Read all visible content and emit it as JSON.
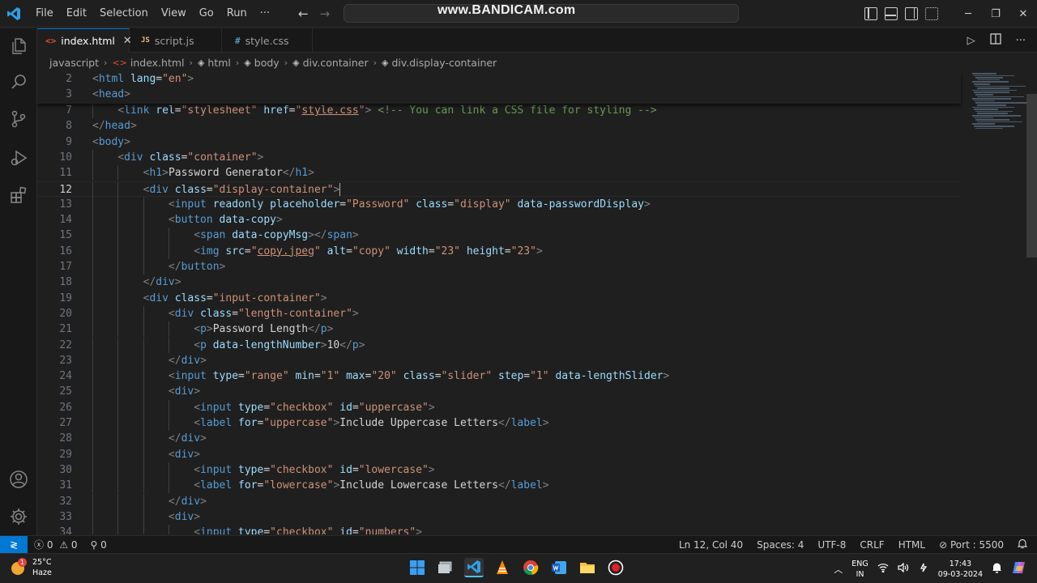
{
  "menu": {
    "items": [
      "File",
      "Edit",
      "Selection",
      "View",
      "Go",
      "Run",
      "···"
    ]
  },
  "titlebar": {
    "watermark": "www.BANDICAM.com",
    "window_controls": [
      "─",
      "❐",
      "✕"
    ]
  },
  "tabs": [
    {
      "label": "index.html",
      "icon": "<>",
      "icon_color": "#e44d26",
      "active": true,
      "close": "✕"
    },
    {
      "label": "script.js",
      "icon": "JS",
      "icon_color": "#e5c07b",
      "active": false
    },
    {
      "label": "style.css",
      "icon": "#",
      "icon_color": "#519aba",
      "active": false
    }
  ],
  "breadcrumb": [
    "javascript",
    "index.html",
    "html",
    "body",
    "div.container",
    "div.display-container"
  ],
  "editor": {
    "current_line": 12,
    "lines": [
      {
        "n": "2",
        "html": "<span class=\"p\">&lt;</span><span class=\"t\">html</span> <span class=\"a\">lang</span><span class=\"x\">=</span><span class=\"s\">\"en\"</span><span class=\"p\">&gt;</span>"
      },
      {
        "n": "3",
        "html": "<span class=\"p\">&lt;</span><span class=\"t\">head</span><span class=\"p\">&gt;</span>"
      },
      {
        "n": "7",
        "html": "    <span class=\"p\">&lt;</span><span class=\"t\">link</span> <span class=\"a\">rel</span><span class=\"x\">=</span><span class=\"s\">\"stylesheet\"</span> <span class=\"a\">href</span><span class=\"x\">=</span><span class=\"s\">\"</span><span class=\"u\">style.css</span><span class=\"s\">\"</span><span class=\"p\">&gt;</span> <span class=\"c\">&lt;!-- You can link a CSS file for styling --&gt;</span>"
      },
      {
        "n": "8",
        "html": "<span class=\"p\">&lt;/</span><span class=\"t\">head</span><span class=\"p\">&gt;</span>"
      },
      {
        "n": "9",
        "html": "<span class=\"p\">&lt;</span><span class=\"t\">body</span><span class=\"p\">&gt;</span>"
      },
      {
        "n": "10",
        "html": "    <span class=\"p\">&lt;</span><span class=\"t\">div</span> <span class=\"a\">class</span><span class=\"x\">=</span><span class=\"s\">\"container\"</span><span class=\"p\">&gt;</span>"
      },
      {
        "n": "11",
        "html": "        <span class=\"p\">&lt;</span><span class=\"t\">h1</span><span class=\"p\">&gt;</span><span class=\"x\">Password Generator</span><span class=\"p\">&lt;/</span><span class=\"t\">h1</span><span class=\"p\">&gt;</span>"
      },
      {
        "n": "12",
        "html": "        <span class=\"p\">&lt;</span><span class=\"t\">div</span> <span class=\"a\">class</span><span class=\"x\">=</span><span class=\"s\">\"display-container\"</span><span class=\"p\">&gt;</span><span class=\"caret\"></span>"
      },
      {
        "n": "13",
        "html": "            <span class=\"p\">&lt;</span><span class=\"t\">input</span> <span class=\"a\">readonly</span> <span class=\"a\">placeholder</span><span class=\"x\">=</span><span class=\"s\">\"Password\"</span> <span class=\"a\">class</span><span class=\"x\">=</span><span class=\"s\">\"display\"</span> <span class=\"a\">data-passwordDisplay</span><span class=\"p\">&gt;</span>"
      },
      {
        "n": "14",
        "html": "            <span class=\"p\">&lt;</span><span class=\"t\">button</span> <span class=\"a\">data-copy</span><span class=\"p\">&gt;</span>"
      },
      {
        "n": "15",
        "html": "                <span class=\"p\">&lt;</span><span class=\"t\">span</span> <span class=\"a\">data-copyMsg</span><span class=\"p\">&gt;&lt;/</span><span class=\"t\">span</span><span class=\"p\">&gt;</span>"
      },
      {
        "n": "16",
        "html": "                <span class=\"p\">&lt;</span><span class=\"t\">img</span> <span class=\"a\">src</span><span class=\"x\">=</span><span class=\"s\">\"</span><span class=\"u\">copy.jpeg</span><span class=\"s\">\"</span> <span class=\"a\">alt</span><span class=\"x\">=</span><span class=\"s\">\"copy\"</span> <span class=\"a\">width</span><span class=\"x\">=</span><span class=\"s\">\"23\"</span> <span class=\"a\">height</span><span class=\"x\">=</span><span class=\"s\">\"23\"</span><span class=\"p\">&gt;</span>"
      },
      {
        "n": "17",
        "html": "            <span class=\"p\">&lt;/</span><span class=\"t\">button</span><span class=\"p\">&gt;</span>"
      },
      {
        "n": "18",
        "html": "        <span class=\"p\">&lt;/</span><span class=\"t\">div</span><span class=\"p\">&gt;</span>"
      },
      {
        "n": "19",
        "html": "        <span class=\"p\">&lt;</span><span class=\"t\">div</span> <span class=\"a\">class</span><span class=\"x\">=</span><span class=\"s\">\"input-container\"</span><span class=\"p\">&gt;</span>"
      },
      {
        "n": "20",
        "html": "            <span class=\"p\">&lt;</span><span class=\"t\">div</span> <span class=\"a\">class</span><span class=\"x\">=</span><span class=\"s\">\"length-container\"</span><span class=\"p\">&gt;</span>"
      },
      {
        "n": "21",
        "html": "                <span class=\"p\">&lt;</span><span class=\"t\">p</span><span class=\"p\">&gt;</span><span class=\"x\">Password Length</span><span class=\"p\">&lt;/</span><span class=\"t\">p</span><span class=\"p\">&gt;</span>"
      },
      {
        "n": "22",
        "html": "                <span class=\"p\">&lt;</span><span class=\"t\">p</span> <span class=\"a\">data-lengthNumber</span><span class=\"p\">&gt;</span><span class=\"x\">10</span><span class=\"p\">&lt;/</span><span class=\"t\">p</span><span class=\"p\">&gt;</span>"
      },
      {
        "n": "23",
        "html": "            <span class=\"p\">&lt;/</span><span class=\"t\">div</span><span class=\"p\">&gt;</span>"
      },
      {
        "n": "24",
        "html": "            <span class=\"p\">&lt;</span><span class=\"t\">input</span> <span class=\"a\">type</span><span class=\"x\">=</span><span class=\"s\">\"range\"</span> <span class=\"a\">min</span><span class=\"x\">=</span><span class=\"s\">\"1\"</span> <span class=\"a\">max</span><span class=\"x\">=</span><span class=\"s\">\"20\"</span> <span class=\"a\">class</span><span class=\"x\">=</span><span class=\"s\">\"slider\"</span> <span class=\"a\">step</span><span class=\"x\">=</span><span class=\"s\">\"1\"</span> <span class=\"a\">data-lengthSlider</span><span class=\"p\">&gt;</span>"
      },
      {
        "n": "25",
        "html": "            <span class=\"p\">&lt;</span><span class=\"t\">div</span><span class=\"p\">&gt;</span>"
      },
      {
        "n": "26",
        "html": "                <span class=\"p\">&lt;</span><span class=\"t\">input</span> <span class=\"a\">type</span><span class=\"x\">=</span><span class=\"s\">\"checkbox\"</span> <span class=\"a\">id</span><span class=\"x\">=</span><span class=\"s\">\"uppercase\"</span><span class=\"p\">&gt;</span>"
      },
      {
        "n": "27",
        "html": "                <span class=\"p\">&lt;</span><span class=\"t\">label</span> <span class=\"a\">for</span><span class=\"x\">=</span><span class=\"s\">\"uppercase\"</span><span class=\"p\">&gt;</span><span class=\"x\">Include Uppercase Letters</span><span class=\"p\">&lt;/</span><span class=\"t\">label</span><span class=\"p\">&gt;</span>"
      },
      {
        "n": "28",
        "html": "            <span class=\"p\">&lt;/</span><span class=\"t\">div</span><span class=\"p\">&gt;</span>"
      },
      {
        "n": "29",
        "html": "            <span class=\"p\">&lt;</span><span class=\"t\">div</span><span class=\"p\">&gt;</span>"
      },
      {
        "n": "30",
        "html": "                <span class=\"p\">&lt;</span><span class=\"t\">input</span> <span class=\"a\">type</span><span class=\"x\">=</span><span class=\"s\">\"checkbox\"</span> <span class=\"a\">id</span><span class=\"x\">=</span><span class=\"s\">\"lowercase\"</span><span class=\"p\">&gt;</span>"
      },
      {
        "n": "31",
        "html": "                <span class=\"p\">&lt;</span><span class=\"t\">label</span> <span class=\"a\">for</span><span class=\"x\">=</span><span class=\"s\">\"lowercase\"</span><span class=\"p\">&gt;</span><span class=\"x\">Include Lowercase Letters</span><span class=\"p\">&lt;/</span><span class=\"t\">label</span><span class=\"p\">&gt;</span>"
      },
      {
        "n": "32",
        "html": "            <span class=\"p\">&lt;/</span><span class=\"t\">div</span><span class=\"p\">&gt;</span>"
      },
      {
        "n": "33",
        "html": "            <span class=\"p\">&lt;</span><span class=\"t\">div</span><span class=\"p\">&gt;</span>"
      },
      {
        "n": "34",
        "html": "                <span class=\"p\">&lt;</span><span class=\"t\">input</span> <span class=\"a\">type</span><span class=\"x\">=</span><span class=\"s\">\"checkbox\"</span> <span class=\"a\">id</span><span class=\"x\">=</span><span class=\"s\">\"numbers\"</span><span class=\"p\">&gt;</span>"
      }
    ]
  },
  "statusbar": {
    "errors": "0",
    "warnings": "0",
    "ports_count": "0",
    "position": "Ln 12, Col 40",
    "spaces": "Spaces: 4",
    "encoding": "UTF-8",
    "eol": "CRLF",
    "language": "HTML",
    "port": "Port : 5500"
  },
  "taskbar": {
    "temperature": "25°C",
    "weather": "Haze",
    "weather_badge": "1",
    "lang_top": "ENG",
    "lang_bottom": "IN",
    "time": "17:43",
    "date": "09-03-2024"
  },
  "colors": {
    "accent": "#0078d4",
    "editor_bg": "#1f1f1f",
    "tag": "#569cd6",
    "attr": "#9cdcfe",
    "string": "#ce9178",
    "comment": "#6a9955"
  }
}
